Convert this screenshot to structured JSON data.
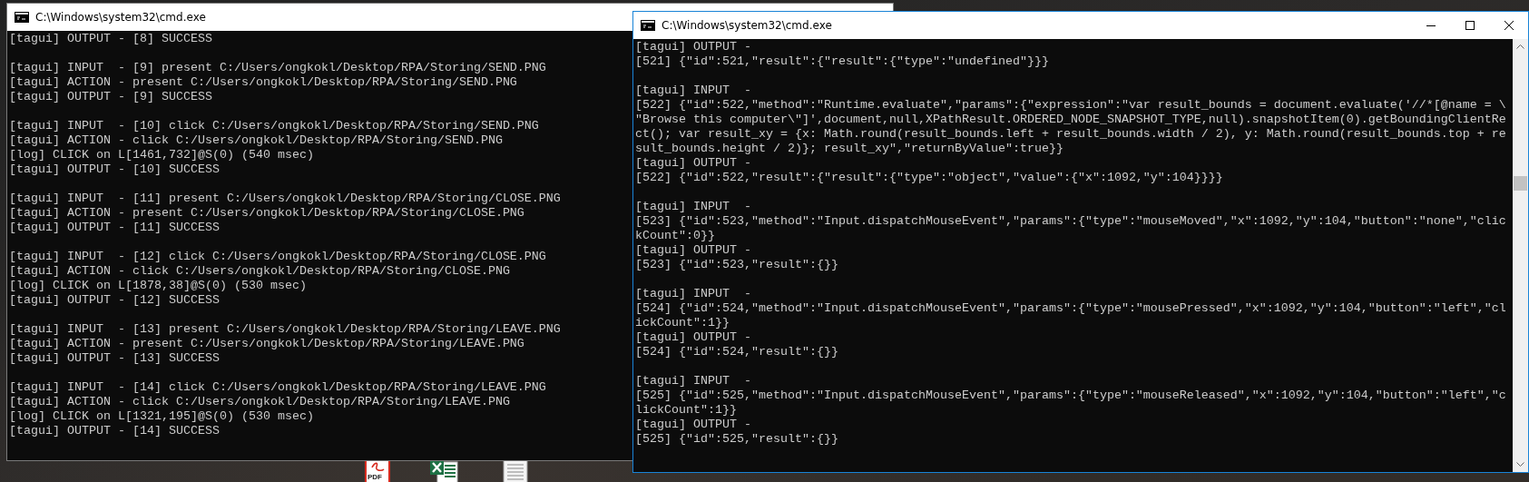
{
  "desktop_icons": [
    {
      "kind": "pdf",
      "label": "PDF"
    },
    {
      "kind": "excel"
    },
    {
      "kind": "text"
    }
  ],
  "windows": [
    {
      "title": "C:\\Windows\\system32\\cmd.exe",
      "active": false,
      "blocks": [
        [
          "[tagui] OUTPUT - [8] SUCCESS"
        ],
        [
          "[tagui] INPUT  - [9] present C:/Users/ongkokl/Desktop/RPA/Storing/SEND.PNG",
          "[tagui] ACTION - present C:/Users/ongkokl/Desktop/RPA/Storing/SEND.PNG",
          "[tagui] OUTPUT - [9] SUCCESS"
        ],
        [
          "[tagui] INPUT  - [10] click C:/Users/ongkokl/Desktop/RPA/Storing/SEND.PNG",
          "[tagui] ACTION - click C:/Users/ongkokl/Desktop/RPA/Storing/SEND.PNG",
          "[log] CLICK on L[1461,732]@S(0) (540 msec)",
          "[tagui] OUTPUT - [10] SUCCESS"
        ],
        [
          "[tagui] INPUT  - [11] present C:/Users/ongkokl/Desktop/RPA/Storing/CLOSE.PNG",
          "[tagui] ACTION - present C:/Users/ongkokl/Desktop/RPA/Storing/CLOSE.PNG",
          "[tagui] OUTPUT - [11] SUCCESS"
        ],
        [
          "[tagui] INPUT  - [12] click C:/Users/ongkokl/Desktop/RPA/Storing/CLOSE.PNG",
          "[tagui] ACTION - click C:/Users/ongkokl/Desktop/RPA/Storing/CLOSE.PNG",
          "[log] CLICK on L[1878,38]@S(0) (530 msec)",
          "[tagui] OUTPUT - [12] SUCCESS"
        ],
        [
          "[tagui] INPUT  - [13] present C:/Users/ongkokl/Desktop/RPA/Storing/LEAVE.PNG",
          "[tagui] ACTION - present C:/Users/ongkokl/Desktop/RPA/Storing/LEAVE.PNG",
          "[tagui] OUTPUT - [13] SUCCESS"
        ],
        [
          "[tagui] INPUT  - [14] click C:/Users/ongkokl/Desktop/RPA/Storing/LEAVE.PNG",
          "[tagui] ACTION - click C:/Users/ongkokl/Desktop/RPA/Storing/LEAVE.PNG",
          "[log] CLICK on L[1321,195]@S(0) (530 msec)",
          "[tagui] OUTPUT - [14] SUCCESS"
        ]
      ]
    },
    {
      "title": "C:\\Windows\\system32\\cmd.exe",
      "active": true,
      "scrollbar": true,
      "caption_buttons": [
        {
          "kind": "minimize"
        },
        {
          "kind": "maximize"
        },
        {
          "kind": "close"
        }
      ],
      "blocks": [
        [
          "[tagui] OUTPUT -",
          "[521] {\"id\":521,\"result\":{\"result\":{\"type\":\"undefined\"}}}"
        ],
        [
          "[tagui] INPUT  -",
          "[522] {\"id\":522,\"method\":\"Runtime.evaluate\",\"params\":{\"expression\":\"var result_bounds = document.evaluate('//*[@name = \\",
          "\"Browse this computer\\\"]',document,null,XPathResult.ORDERED_NODE_SNAPSHOT_TYPE,null).snapshotItem(0).getBoundingClientRe",
          "ct(); var result_xy = {x: Math.round(result_bounds.left + result_bounds.width / 2), y: Math.round(result_bounds.top + re",
          "sult_bounds.height / 2)}; result_xy\",\"returnByValue\":true}}",
          "[tagui] OUTPUT -",
          "[522] {\"id\":522,\"result\":{\"result\":{\"type\":\"object\",\"value\":{\"x\":1092,\"y\":104}}}}"
        ],
        [
          "[tagui] INPUT  -",
          "[523] {\"id\":523,\"method\":\"Input.dispatchMouseEvent\",\"params\":{\"type\":\"mouseMoved\",\"x\":1092,\"y\":104,\"button\":\"none\",\"clic",
          "kCount\":0}}",
          "[tagui] OUTPUT -",
          "[523] {\"id\":523,\"result\":{}}"
        ],
        [
          "[tagui] INPUT  -",
          "[524] {\"id\":524,\"method\":\"Input.dispatchMouseEvent\",\"params\":{\"type\":\"mousePressed\",\"x\":1092,\"y\":104,\"button\":\"left\",\"cl",
          "ickCount\":1}}",
          "[tagui] OUTPUT -",
          "[524] {\"id\":524,\"result\":{}}"
        ],
        [
          "[tagui] INPUT  -",
          "[525] {\"id\":525,\"method\":\"Input.dispatchMouseEvent\",\"params\":{\"type\":\"mouseReleased\",\"x\":1092,\"y\":104,\"button\":\"left\",\"c",
          "lickCount\":1}}",
          "[tagui] OUTPUT -",
          "[525] {\"id\":525,\"result\":{}}"
        ]
      ]
    }
  ]
}
